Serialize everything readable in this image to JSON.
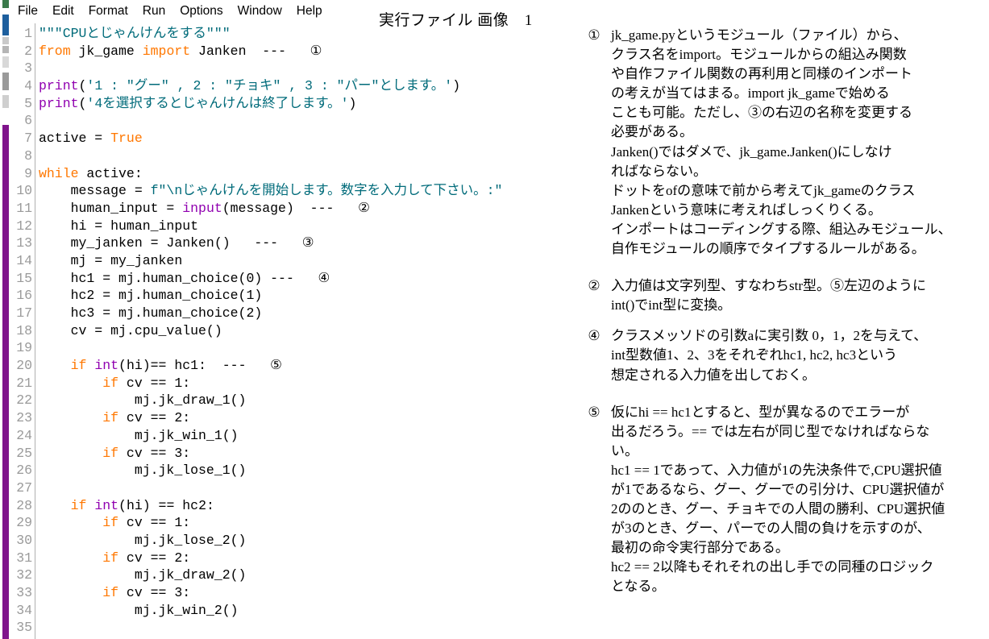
{
  "window": {
    "app": "IDLE Python Editor",
    "menubar": [
      {
        "label": "File"
      },
      {
        "label": "Edit"
      },
      {
        "label": "Format"
      },
      {
        "label": "Run"
      },
      {
        "label": "Options"
      },
      {
        "label": "Window"
      },
      {
        "label": "Help"
      }
    ]
  },
  "document_title": "実行ファイル 画像　1",
  "colors": {
    "keyword": "#ff7700",
    "builtin": "#9000b0",
    "string": "#006b7a",
    "gutter_text": "#9a9a9a",
    "background": "#ffffff",
    "sliver_purple": "#80148c"
  },
  "editor": {
    "line_numbers": [
      1,
      2,
      3,
      4,
      5,
      6,
      7,
      8,
      9,
      10,
      11,
      12,
      13,
      14,
      15,
      16,
      17,
      18,
      19,
      20,
      21,
      22,
      23,
      24,
      25,
      26,
      27,
      28,
      29,
      30,
      31,
      32,
      33,
      34,
      35
    ],
    "lines": [
      {
        "n": 1,
        "text": "\"\"\"CPUとじゃんけんをする\"\"\""
      },
      {
        "n": 2,
        "text": "from jk_game import Janken  ---   ①"
      },
      {
        "n": 3,
        "text": ""
      },
      {
        "n": 4,
        "text": "print('1 : \"グー\" , 2 : \"チョキ\" , 3 : \"パー\"とします。')"
      },
      {
        "n": 5,
        "text": "print('4を選択するとじゃんけんは終了します。')"
      },
      {
        "n": 6,
        "text": ""
      },
      {
        "n": 7,
        "text": "active = True"
      },
      {
        "n": 8,
        "text": ""
      },
      {
        "n": 9,
        "text": "while active:"
      },
      {
        "n": 10,
        "text": "    message = f\"\\nじゃんけんを開始します。数字を入力して下さい。:\""
      },
      {
        "n": 11,
        "text": "    human_input = input(message)  ---   ②"
      },
      {
        "n": 12,
        "text": "    hi = human_input"
      },
      {
        "n": 13,
        "text": "    my_janken = Janken()   ---   ③"
      },
      {
        "n": 14,
        "text": "    mj = my_janken"
      },
      {
        "n": 15,
        "text": "    hc1 = mj.human_choice(0) ---   ④"
      },
      {
        "n": 16,
        "text": "    hc2 = mj.human_choice(1)"
      },
      {
        "n": 17,
        "text": "    hc3 = mj.human_choice(2)"
      },
      {
        "n": 18,
        "text": "    cv = mj.cpu_value()"
      },
      {
        "n": 19,
        "text": ""
      },
      {
        "n": 20,
        "text": "    if int(hi)== hc1:  ---   ⑤"
      },
      {
        "n": 21,
        "text": "        if cv == 1:"
      },
      {
        "n": 22,
        "text": "            mj.jk_draw_1()"
      },
      {
        "n": 23,
        "text": "        if cv == 2:"
      },
      {
        "n": 24,
        "text": "            mj.jk_win_1()"
      },
      {
        "n": 25,
        "text": "        if cv == 3:"
      },
      {
        "n": 26,
        "text": "            mj.jk_lose_1()"
      },
      {
        "n": 27,
        "text": ""
      },
      {
        "n": 28,
        "text": "    if int(hi) == hc2:"
      },
      {
        "n": 29,
        "text": "        if cv == 1:"
      },
      {
        "n": 30,
        "text": "            mj.jk_lose_2()"
      },
      {
        "n": 31,
        "text": "        if cv == 2:"
      },
      {
        "n": 32,
        "text": "            mj.jk_draw_2()"
      },
      {
        "n": 33,
        "text": "        if cv == 3:"
      },
      {
        "n": 34,
        "text": "            mj.jk_win_2()"
      },
      {
        "n": 35,
        "text": ""
      }
    ]
  },
  "notes": [
    {
      "marker": "①",
      "lines": [
        "jk_game.pyというモジュール（ファイル）から、",
        "クラス名をimport。モジュールからの組込み関数",
        "や自作ファイル関数の再利用と同様のインポート",
        "の考えが当てはまる。import jk_gameで始める",
        "ことも可能。ただし、③の右辺の名称を変更する",
        "必要がある。",
        "Janken()ではダメで、jk_game.Janken()にしなけ",
        "ればならない。",
        "ドットをofの意味で前から考えてjk_gameのクラス",
        "Jankenという意味に考えればしっくりくる。",
        "インポートはコーディングする際、組込みモジュール、",
        "自作モジュールの順序でタイプするルールがある。"
      ]
    },
    {
      "marker": "②",
      "lines": [
        "入力値は文字列型、すなわちstr型。⑤左辺のように",
        "int()でint型に変換。"
      ]
    },
    {
      "marker": "④",
      "lines": [
        "クラスメッソドの引数aに実引数 0，1，2を与えて、",
        "int型数値1、2、3をそれぞれhc1, hc2, hc3という",
        "想定される入力値を出しておく。"
      ]
    },
    {
      "marker": "⑤",
      "lines": [
        "仮にhi == hc1とすると、型が異なるのでエラーが",
        "出るだろう。== では左右が同じ型でなければならな",
        "い。",
        "hc1 == 1であって、入力値が1の先決条件で,CPU選択値",
        "が1であるなら、グー、グーでの引分け、CPU選択値が",
        "2ののとき、グー、チョキでの人間の勝利、CPU選択値",
        "が3のとき、グー、パーでの人間の負けを示すのが、",
        "最初の命令実行部分である。",
        "hc2 == 2以降もそれそれの出し手での同種のロジック",
        "となる。"
      ]
    }
  ]
}
